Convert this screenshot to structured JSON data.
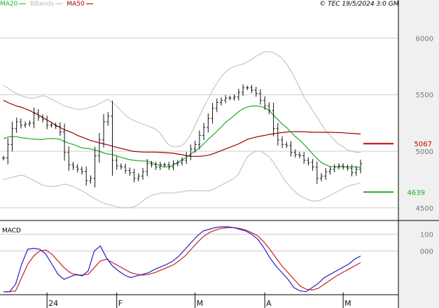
{
  "header": {
    "legend": [
      {
        "label": "MA20",
        "color": "#22aa22"
      },
      {
        "label": "BBands",
        "color": "#bbbbbb"
      },
      {
        "label": "MA50",
        "color": "#990000"
      }
    ],
    "copyright": "© TEC 19/5/2024 3:0 GMT"
  },
  "colors": {
    "background": "#ffffff",
    "axis_bg": "#f0f0f0",
    "grid": "#cccccc",
    "ohlc": "#111111",
    "ma20": "#22aa22",
    "ma50": "#990000",
    "bbands": "#bbbbbb",
    "macd_line": "#2222cc",
    "signal_line": "#cc2222",
    "resistance": "#cc0000",
    "support": "#22aa22"
  },
  "chart_data": [
    {
      "type": "ohlc",
      "indicators": [
        "MA20",
        "BBands",
        "MA50"
      ],
      "y_axis": {
        "range": [
          4400,
          6250
        ],
        "ticks": [
          4500,
          5000,
          5500,
          6000
        ],
        "tick_labels": [
          "4500",
          "5000",
          "5500",
          "6000"
        ]
      },
      "x_axis": {
        "tick_labels": [
          "24",
          "F",
          "M",
          "A",
          "M"
        ],
        "tick_index": [
          10,
          26,
          44,
          60,
          78
        ]
      },
      "levels": [
        {
          "name": "resistance",
          "value": 5067,
          "label": "5067",
          "color": "#cc0000"
        },
        {
          "name": "support",
          "value": 4639,
          "label": "4639",
          "color": "#22aa22"
        }
      ],
      "close": [
        4940,
        5060,
        5200,
        5260,
        5230,
        5240,
        5250,
        5340,
        5300,
        5280,
        5230,
        5230,
        5220,
        5170,
        4990,
        4880,
        4860,
        4840,
        4820,
        4740,
        4760,
        4960,
        5100,
        5260,
        5310,
        4920,
        4870,
        4860,
        4830,
        4810,
        4760,
        4780,
        4820,
        4890,
        4880,
        4860,
        4880,
        4880,
        4860,
        4890,
        4900,
        4920,
        4960,
        5020,
        5060,
        5140,
        5210,
        5290,
        5380,
        5430,
        5450,
        5470,
        5470,
        5480,
        5520,
        5560,
        5560,
        5540,
        5510,
        5450,
        5400,
        5360,
        5200,
        5100,
        5060,
        5050,
        4990,
        4970,
        4960,
        4920,
        4900,
        4860,
        4760,
        4780,
        4820,
        4840,
        4860,
        4870,
        4860,
        4850,
        4810,
        4840,
        4890
      ],
      "ma20": [
        5110,
        5125,
        5130,
        5128,
        5120,
        5115,
        5110,
        5108,
        5105,
        5105,
        5110,
        5112,
        5110,
        5105,
        5085,
        5070,
        5060,
        5045,
        5030,
        5025,
        5020,
        5010,
        5000,
        4985,
        4975,
        4970,
        4960,
        4945,
        4935,
        4925,
        4920,
        4915,
        4915,
        4912,
        4900,
        4885,
        4872,
        4860,
        4865,
        4880,
        4900,
        4925,
        4945,
        4975,
        5000,
        5030,
        5065,
        5105,
        5140,
        5175,
        5215,
        5255,
        5285,
        5315,
        5350,
        5375,
        5390,
        5400,
        5400,
        5395,
        5385,
        5360,
        5320,
        5280,
        5240,
        5210,
        5170,
        5130,
        5100,
        5060,
        5020,
        4975,
        4935,
        4900,
        4880,
        4865,
        4862,
        4862,
        4862,
        4862,
        4862,
        4860,
        4858
      ],
      "ma50": [
        5450,
        5430,
        5415,
        5400,
        5390,
        5375,
        5360,
        5340,
        5320,
        5300,
        5275,
        5255,
        5230,
        5210,
        5190,
        5175,
        5160,
        5140,
        5125,
        5110,
        5095,
        5085,
        5075,
        5065,
        5055,
        5045,
        5035,
        5025,
        5015,
        5005,
        4998,
        4995,
        4993,
        4992,
        4992,
        4992,
        4990,
        4988,
        4985,
        4982,
        4975,
        4970,
        4960,
        4955,
        4955,
        4955,
        4958,
        4965,
        4975,
        4990,
        5005,
        5020,
        5035,
        5050,
        5065,
        5085,
        5105,
        5115,
        5125,
        5133,
        5140,
        5148,
        5155,
        5160,
        5165,
        5170,
        5172,
        5173,
        5173,
        5172,
        5170,
        5168,
        5167,
        5167,
        5167,
        5167,
        5166,
        5165,
        5163,
        5160,
        5158,
        5155,
        5152
      ],
      "bb_upper": [
        5580,
        5560,
        5530,
        5510,
        5490,
        5480,
        5470,
        5470,
        5480,
        5490,
        5480,
        5460,
        5440,
        5420,
        5400,
        5390,
        5380,
        5370,
        5370,
        5380,
        5390,
        5400,
        5420,
        5440,
        5460,
        5430,
        5400,
        5360,
        5320,
        5290,
        5270,
        5255,
        5240,
        5225,
        5210,
        5195,
        5160,
        5100,
        5055,
        5040,
        5040,
        5050,
        5090,
        5150,
        5230,
        5310,
        5390,
        5460,
        5540,
        5600,
        5660,
        5700,
        5730,
        5750,
        5760,
        5770,
        5790,
        5810,
        5840,
        5860,
        5880,
        5880,
        5870,
        5850,
        5820,
        5770,
        5710,
        5640,
        5560,
        5480,
        5420,
        5360,
        5300,
        5240,
        5180,
        5140,
        5100,
        5060,
        5040,
        5010,
        5000,
        4990,
        4990
      ],
      "bb_lower": [
        4750,
        4760,
        4770,
        4780,
        4790,
        4780,
        4760,
        4740,
        4720,
        4700,
        4690,
        4690,
        4690,
        4700,
        4710,
        4700,
        4690,
        4670,
        4650,
        4630,
        4600,
        4580,
        4560,
        4540,
        4530,
        4520,
        4510,
        4500,
        4500,
        4500,
        4510,
        4530,
        4560,
        4590,
        4610,
        4620,
        4630,
        4630,
        4630,
        4630,
        4640,
        4640,
        4650,
        4650,
        4650,
        4650,
        4650,
        4650,
        4660,
        4680,
        4700,
        4720,
        4740,
        4760,
        4800,
        4880,
        4950,
        4980,
        5000,
        5000,
        4980,
        4950,
        4900,
        4840,
        4780,
        4720,
        4680,
        4640,
        4610,
        4590,
        4570,
        4560,
        4560,
        4570,
        4590,
        4610,
        4630,
        4650,
        4670,
        4690,
        4700,
        4710,
        4720
      ]
    },
    {
      "type": "line",
      "title": "MACD",
      "y_axis": {
        "range": [
          -250,
          170
        ],
        "ticks": [
          0,
          100
        ],
        "tick_labels": [
          "000",
          "100"
        ]
      },
      "series": [
        {
          "values": [
            -310,
            -280,
            -200,
            -80,
            10,
            15,
            10,
            -20,
            -80,
            -140,
            -170,
            -155,
            -140,
            -150,
            -120,
            0,
            30,
            -40,
            -90,
            -120,
            -145,
            -160,
            -150,
            -140,
            -130,
            -110,
            -95,
            -80,
            -60,
            -30,
            10,
            50,
            90,
            120,
            130,
            140,
            145,
            145,
            140,
            130,
            120,
            100,
            70,
            20,
            -40,
            -90,
            -130,
            -170,
            -220,
            -240,
            -245,
            -220,
            -195,
            -160,
            -140,
            -120,
            -100,
            -80,
            -50,
            -30
          ]
        },
        {
          "values": [
            -300,
            -290,
            -240,
            -160,
            -80,
            -30,
            0,
            5,
            -20,
            -60,
            -100,
            -130,
            -145,
            -145,
            -140,
            -100,
            -60,
            -50,
            -70,
            -90,
            -110,
            -130,
            -140,
            -145,
            -140,
            -130,
            -115,
            -100,
            -85,
            -60,
            -30,
            10,
            50,
            85,
            110,
            125,
            135,
            140,
            140,
            135,
            125,
            110,
            90,
            55,
            10,
            -40,
            -90,
            -130,
            -170,
            -210,
            -230,
            -235,
            -225,
            -200,
            -175,
            -150,
            -130,
            -110,
            -90,
            -70
          ]
        }
      ]
    }
  ]
}
